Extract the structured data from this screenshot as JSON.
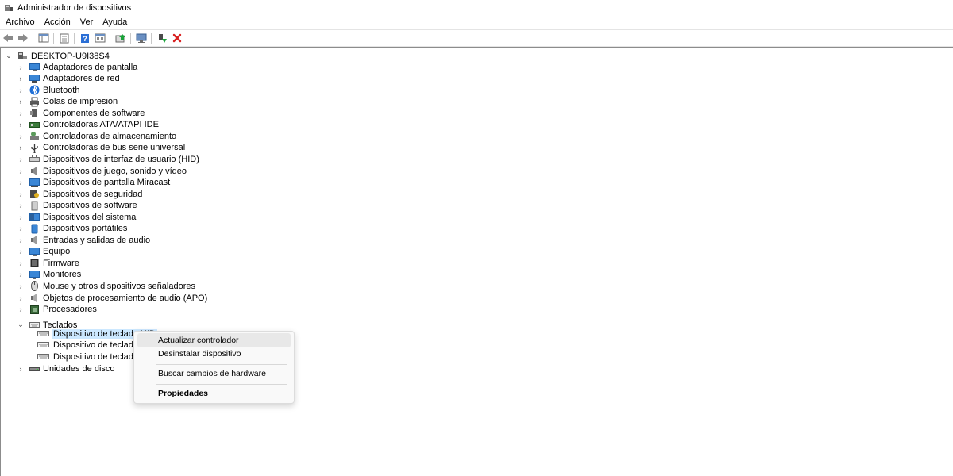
{
  "window": {
    "title": "Administrador de dispositivos"
  },
  "menu": [
    "Archivo",
    "Acción",
    "Ver",
    "Ayuda"
  ],
  "toolbar": {
    "buttons": [
      "back-arrow-icon",
      "forward-arrow-icon",
      "show-hide-tree-icon",
      "properties-icon",
      "help-icon",
      "view-icon",
      "update-driver-icon",
      "scan-hardware-icon",
      "enable-device-icon",
      "uninstall-icon"
    ],
    "colors": {
      "back_forward": "#6d6d6d",
      "help": "#2b6fd6",
      "uninstall": "#d81e1e",
      "enable": "#1aa33a"
    }
  },
  "tree": {
    "root": "DESKTOP-U9I38S4",
    "categories": [
      "Adaptadores de pantalla",
      "Adaptadores de red",
      "Bluetooth",
      "Colas de impresión",
      "Componentes de software",
      "Controladoras ATA/ATAPI IDE",
      "Controladoras de almacenamiento",
      "Controladoras de bus serie universal",
      "Dispositivos de interfaz de usuario (HID)",
      "Dispositivos de juego, sonido y vídeo",
      "Dispositivos de pantalla Miracast",
      "Dispositivos de seguridad",
      "Dispositivos de software",
      "Dispositivos del sistema",
      "Dispositivos portátiles",
      "Entradas y salidas de audio",
      "Equipo",
      "Firmware",
      "Monitores",
      "Mouse y otros dispositivos señaladores",
      "Objetos de procesamiento de audio (APO)",
      "Procesadores",
      "Teclados"
    ],
    "keyboards": [
      "Dispositivo de teclado HID",
      "Dispositivo de teclado H",
      "Dispositivo de teclado H"
    ],
    "last": "Unidades de disco",
    "selection_color": "#cce8ff"
  },
  "context_menu": {
    "update_driver": "Actualizar controlador",
    "uninstall": "Desinstalar dispositivo",
    "scan": "Buscar cambios de hardware",
    "properties": "Propiedades"
  }
}
